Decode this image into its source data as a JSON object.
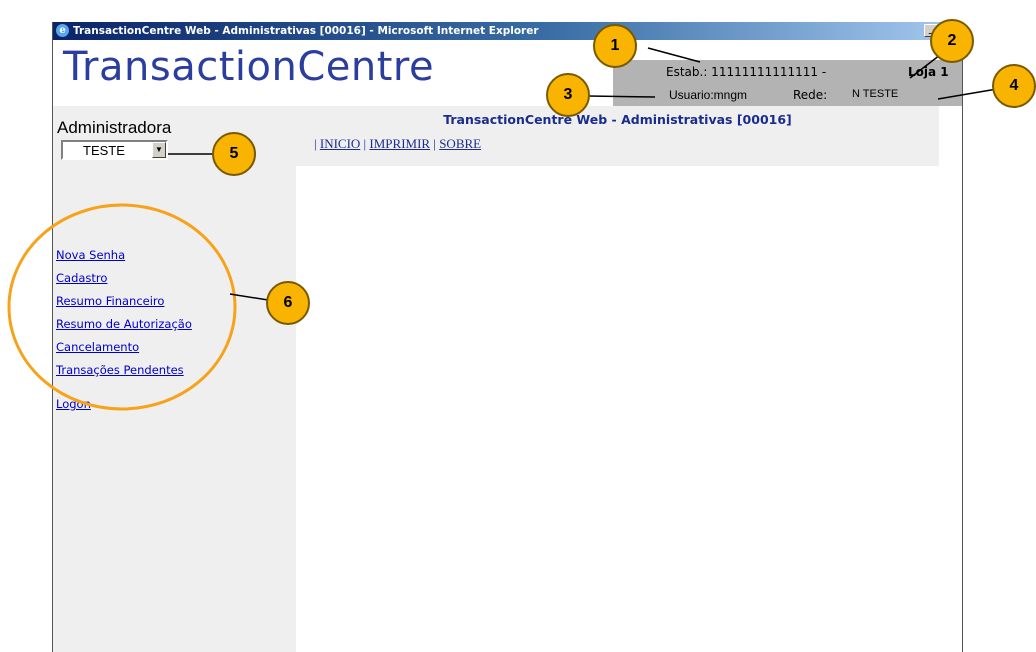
{
  "window": {
    "title": "TransactionCentre Web - Administrativas [00016] - Microsoft Internet Explorer",
    "minimize_label": "_",
    "maximize_label": "□"
  },
  "header": {
    "logo": "TransactionCentre",
    "estab": "Estab.: 11111111111111 -",
    "loja": "Loja 1",
    "usuario": "Usuario:mngm",
    "rede_label": "Rede:",
    "rede_value": "N TESTE"
  },
  "sidebar": {
    "administradora_label": "Administradora",
    "select_value": "TESTE",
    "menu": [
      "Nova Senha",
      "Cadastro",
      "Resumo Financeiro",
      "Resumo de Autorização",
      "Cancelamento",
      "Transações Pendentes",
      "Logon"
    ]
  },
  "content": {
    "title": "TransactionCentre Web - Administrativas [00016]",
    "nav": [
      "INICIO",
      "IMPRIMIR",
      "SOBRE"
    ],
    "separator": "|"
  },
  "callouts": [
    "1",
    "2",
    "3",
    "4",
    "5",
    "6"
  ],
  "colors": {
    "callout_fill": "#f8b400",
    "circle_stroke": "#f7a21b",
    "link": "#0000cc",
    "logo": "#2b3e9e",
    "infobox": "#b3b3b3"
  }
}
